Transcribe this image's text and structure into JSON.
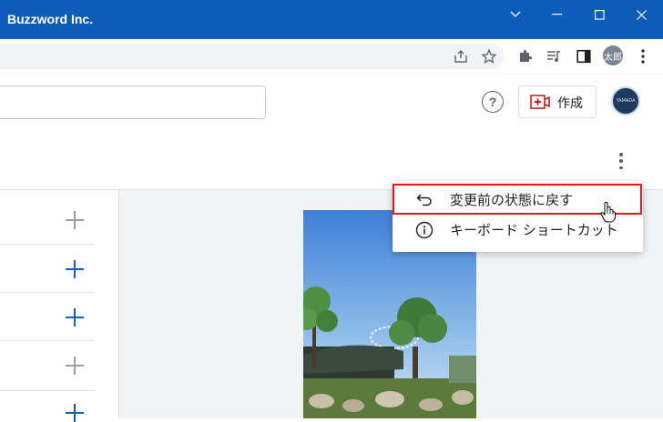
{
  "window": {
    "title": "Buzzword Inc."
  },
  "browser": {
    "profile_label": "太郎"
  },
  "appbar": {
    "help_label": "?",
    "create_label": "作成",
    "avatar_text": "YAMADA"
  },
  "menu": {
    "items": [
      {
        "label": "変更前の状態に戻す",
        "icon": "undo-icon",
        "highlighted": true
      },
      {
        "label": "キーボード ショートカット",
        "icon": "info-icon",
        "highlighted": false
      }
    ]
  },
  "colors": {
    "titlebar": "#0d5db8",
    "highlight_border": "#e8141b",
    "plus_active": "#1a5fb4",
    "plus_inactive": "#9aa0a6"
  }
}
